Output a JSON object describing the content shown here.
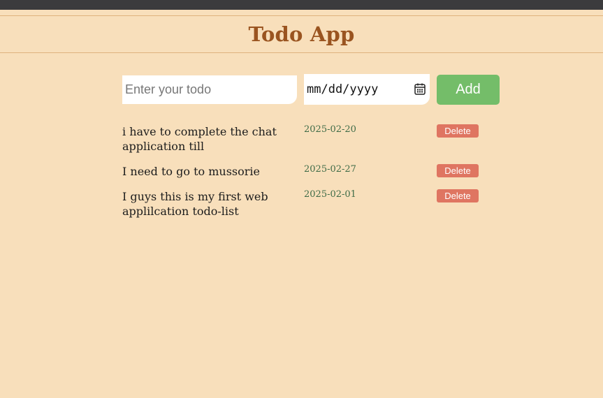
{
  "header": {
    "title": "Todo App"
  },
  "form": {
    "todo_placeholder": "Enter your todo",
    "date_placeholder": "mm/dd/yyyy",
    "add_label": "Add"
  },
  "todos": [
    {
      "text": "i have to complete the chat application till",
      "date": "2025-02-20",
      "delete_label": "Delete"
    },
    {
      "text": "I need to go to mussorie",
      "date": "2025-02-27",
      "delete_label": "Delete"
    },
    {
      "text": "I guys this is my first web applilcation todo-list",
      "date": "2025-02-01",
      "delete_label": "Delete"
    }
  ],
  "colors": {
    "background": "#f8dfbb",
    "title": "#9a5420",
    "add_button": "#74bd69",
    "delete_button": "#df7561",
    "date_text": "#3e6b47"
  },
  "icons": {
    "date_picker": "calendar-icon"
  }
}
